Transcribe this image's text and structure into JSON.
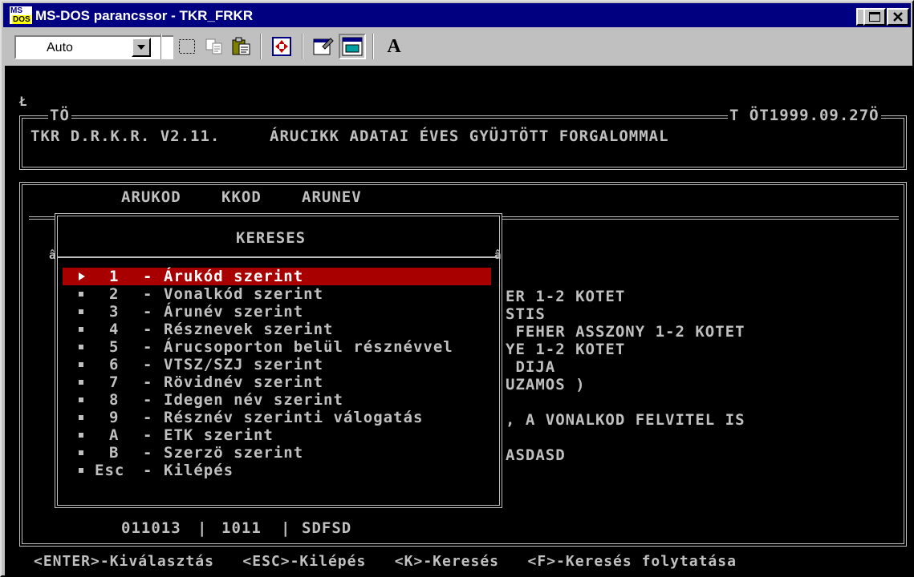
{
  "window": {
    "title": "MS-DOS parancssor - TKR_FRKR",
    "icon_text_top": "MS",
    "icon_text_bottom": "DOS",
    "controls": [
      "minimize-icon",
      "maximize-icon",
      "close-icon"
    ]
  },
  "toolbar": {
    "font_size_value": "Auto",
    "buttons": [
      "mark-icon",
      "copy-icon",
      "paste-icon",
      "fullscreen-icon",
      "properties-icon",
      "background-icon",
      "font-icon"
    ],
    "font_button_label": "A"
  },
  "console": {
    "cursor_char": "Ł",
    "header": {
      "top_left_tag": "TÖ",
      "top_right_tag": "T ÖT1999.09.27Ö",
      "app_name": "TKR D.R.K.R. V2.11.",
      "screen_title": "ÁRUCIKK ADATAI ÉVES GYÜJTÖTT FORGALOMMAL"
    },
    "columns": [
      "ARUKOD",
      "KKOD",
      "ARUNEV"
    ],
    "search_popup": {
      "title": "KERESES",
      "side_marker": "â",
      "items": [
        {
          "key": "1",
          "label": "Árukód szerint",
          "selected": true
        },
        {
          "key": "2",
          "label": "Vonalkód szerint",
          "selected": false
        },
        {
          "key": "3",
          "label": "Árunév szerint",
          "selected": false
        },
        {
          "key": "4",
          "label": "Résznevek szerint",
          "selected": false
        },
        {
          "key": "5",
          "label": "Árucsoporton belül résznévvel",
          "selected": false
        },
        {
          "key": "6",
          "label": "VTSZ/SZJ szerint",
          "selected": false
        },
        {
          "key": "7",
          "label": "Rövidnév szerint",
          "selected": false
        },
        {
          "key": "8",
          "label": "Idegen név szerint",
          "selected": false
        },
        {
          "key": "9",
          "label": "Résznév szerinti válogatás",
          "selected": false
        },
        {
          "key": "A",
          "label": "ETK szerint",
          "selected": false
        },
        {
          "key": "B",
          "label": "Szerzö szerint",
          "selected": false
        },
        {
          "key": "Esc",
          "label": "Kilépés",
          "selected": false
        }
      ]
    },
    "background_rows": [
      "ER 1-2 KOTET",
      "STIS",
      " FEHER ASSZONY 1-2 KOTET",
      "YE 1-2 KOTET",
      " DIJA",
      "UZAMOS )",
      "",
      ", A VONALKOD FELVITEL IS",
      "",
      "ASDASD"
    ],
    "current_record": {
      "arukod": "011013",
      "kkod": "1011",
      "arunev": "SDFSD"
    },
    "status_bar": "<ENTER>-Kiválasztás   <ESC>-Kilépés   <K>-Keresés   <F>-Keresés folytatása",
    "colors": {
      "text": "#c0c0c0",
      "background": "#000000",
      "highlight": "#a80000",
      "highlight_text": "#ffffff"
    }
  }
}
